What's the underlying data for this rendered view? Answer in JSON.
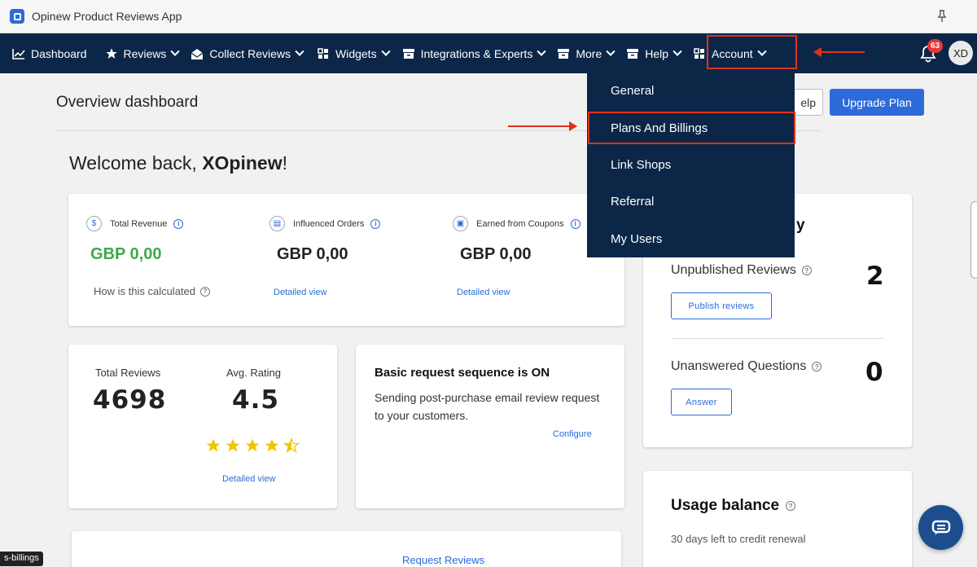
{
  "window": {
    "title": "Opinew Product Reviews App"
  },
  "nav": {
    "items": [
      {
        "label": "Dashboard",
        "icon": "chart-icon"
      },
      {
        "label": "Reviews",
        "icon": "star-icon"
      },
      {
        "label": "Collect Reviews",
        "icon": "envelope-open-icon"
      },
      {
        "label": "Widgets",
        "icon": "grid-icon"
      },
      {
        "label": "Integrations & Experts",
        "icon": "box-icon"
      },
      {
        "label": "More",
        "icon": "box-icon"
      },
      {
        "label": "Help",
        "icon": "box-icon"
      },
      {
        "label": "Account",
        "icon": "grid-icon"
      }
    ],
    "notification_count": "63",
    "avatar_initials": "XD"
  },
  "account_menu": {
    "items": [
      "General",
      "Plans And Billings",
      "Link Shops",
      "Referral",
      "My Users"
    ]
  },
  "header": {
    "title": "Overview dashboard",
    "help_label": "Help",
    "help_visible": "elp",
    "upgrade_label": "Upgrade Plan"
  },
  "welcome": {
    "prefix": "Welcome back, ",
    "name": "XOpinew",
    "suffix": "!"
  },
  "revenue": {
    "total_revenue": {
      "label": "Total Revenue",
      "value": "GBP 0,00",
      "link": "How is this calculated"
    },
    "influenced_orders": {
      "label": "Influenced Orders",
      "value": "GBP 0,00",
      "link": "Detailed view"
    },
    "coupons": {
      "label": "Earned from Coupons",
      "value": "GBP 0,00",
      "link": "Detailed view"
    }
  },
  "reviews": {
    "total_label": "Total Reviews",
    "total_value": "4698",
    "avg_label": "Avg. Rating",
    "avg_value": "4.5",
    "rating": 4.5,
    "link": "Detailed view"
  },
  "sequence": {
    "title": "Basic request sequence is ON",
    "text": "Sending post-purchase email review request to your customers.",
    "link": "Configure"
  },
  "pending": {
    "title_fragment": "y",
    "unpublished_label": "Unpublished Reviews",
    "unpublished_value": "2",
    "publish_button": "Publish reviews",
    "unanswered_label": "Unanswered Questions",
    "unanswered_value": "0",
    "answer_button": "Answer"
  },
  "usage": {
    "title": "Usage balance",
    "subtitle": "30 days left to credit renewal"
  },
  "bottom": {
    "request_link": "Request Reviews"
  },
  "tooltip": "s-billings",
  "colors": {
    "navy": "#0c2648",
    "accent": "#2c6bd9",
    "highlight": "#e0321a",
    "green": "#3daa4a",
    "star": "#f2c500"
  }
}
